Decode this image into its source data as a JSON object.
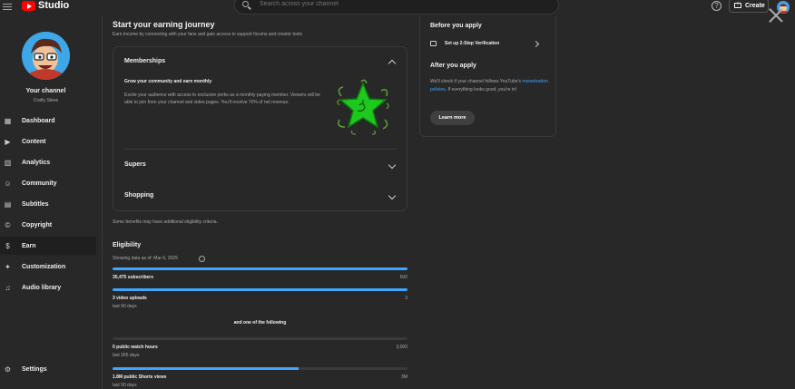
{
  "app": {
    "name": "Studio",
    "brand_color": "#ff0000",
    "accent_color": "#3ea6ff"
  },
  "search": {
    "placeholder": "Search across your channel"
  },
  "header": {
    "create_label": "Create",
    "help_icon": "help-circle-icon"
  },
  "sidebar": {
    "channel_title": "Your channel",
    "channel_name": "Crafty Steve",
    "items": [
      {
        "label": "Dashboard",
        "icon": "dashboard-icon",
        "glyph": "▦"
      },
      {
        "label": "Content",
        "icon": "content-icon",
        "glyph": "▶"
      },
      {
        "label": "Analytics",
        "icon": "analytics-icon",
        "glyph": "▥"
      },
      {
        "label": "Community",
        "icon": "community-icon",
        "glyph": "☺"
      },
      {
        "label": "Subtitles",
        "icon": "subtitles-icon",
        "glyph": "▤"
      },
      {
        "label": "Copyright",
        "icon": "copyright-icon",
        "glyph": "©"
      },
      {
        "label": "Earn",
        "icon": "dollar-icon",
        "glyph": "$"
      },
      {
        "label": "Customization",
        "icon": "customization-icon",
        "glyph": "✦"
      },
      {
        "label": "Audio library",
        "icon": "audio-library-icon",
        "glyph": "♫"
      },
      {
        "label": "Settings",
        "icon": "settings-icon",
        "glyph": "⚙"
      }
    ]
  },
  "main": {
    "title": "Start your earning journey",
    "subtitle": "Earn income by connecting with your fans and gain access to support forums and creator tools",
    "memberships": {
      "title": "Memberships",
      "subtitle": "Grow your community and earn monthly",
      "description": "Excite your audience with access to exclusive perks as a monthly paying member. Viewers will be able to join from your channel and video pages. You'll receive 70% of net revenue."
    },
    "supers": {
      "title": "Supers"
    },
    "shopping": {
      "title": "Shopping"
    },
    "note": "Some benefits may have additional eligibility criteria."
  },
  "eligibility": {
    "title": "Eligibility",
    "date_text": "Showing data as of: Mar 6, 2025",
    "connector": "and one of the following",
    "requirements": [
      {
        "label": "35,475 subscribers",
        "target": "500",
        "sub": "",
        "progress": 1.0
      },
      {
        "label": "3 video uploads",
        "target": "3",
        "sub": "last 90 days",
        "progress": 1.0
      },
      {
        "label": "0 public watch hours",
        "target": "3,000",
        "sub": "last 365 days",
        "progress": 0.0
      },
      {
        "label": "1.8M public Shorts views",
        "target": "3M",
        "sub": "last 90 days",
        "progress": 0.63
      }
    ]
  },
  "right_panel": {
    "before_title": "Before you apply",
    "step_label": "Set up 2-Step Verification",
    "after_title": "After you apply",
    "after_desc_pre": "We'll check if your channel follows YouTube's ",
    "after_desc_link": "monetization policies",
    "after_desc_post": ". If everything looks good, you're in!",
    "learn_more": "Learn more"
  }
}
